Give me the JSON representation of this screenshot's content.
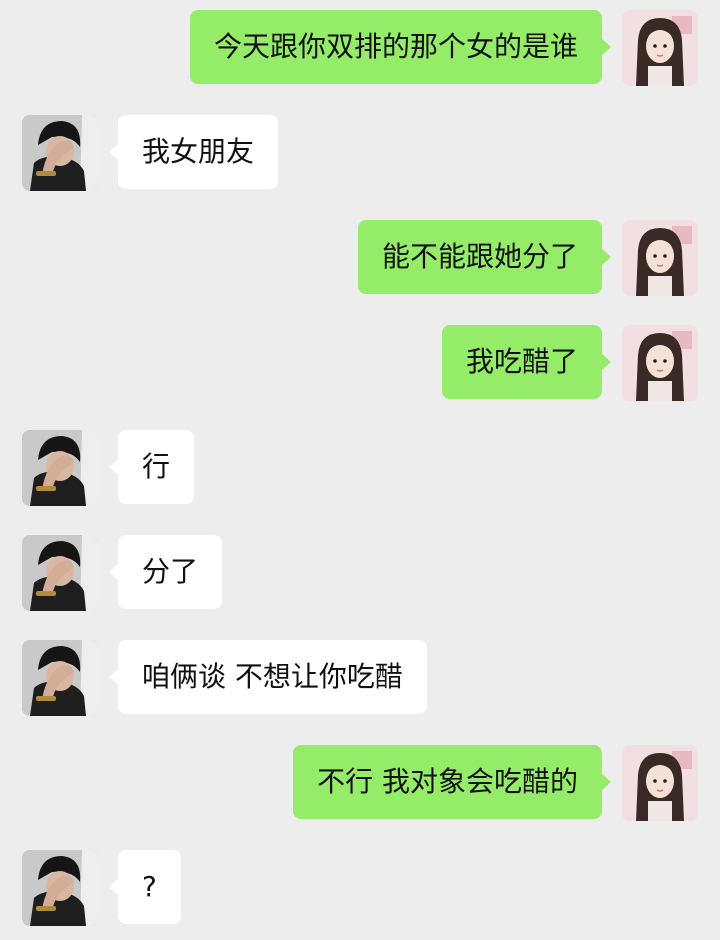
{
  "colors": {
    "background": "#ededed",
    "sent_bubble": "#95ec69",
    "received_bubble": "#ffffff",
    "text": "#111111"
  },
  "icons": {
    "self_avatar": "girl-long-hair-avatar",
    "contact_avatar": "boy-hand-on-face-avatar"
  },
  "messages": [
    {
      "side": "right",
      "text": "今天跟你双排的那个女的是谁"
    },
    {
      "side": "left",
      "text": "我女朋友"
    },
    {
      "side": "right",
      "text": "能不能跟她分了"
    },
    {
      "side": "right",
      "text": "我吃醋了"
    },
    {
      "side": "left",
      "text": "行"
    },
    {
      "side": "left",
      "text": "分了"
    },
    {
      "side": "left",
      "text": "咱俩谈 不想让你吃醋"
    },
    {
      "side": "right",
      "text": "不行 我对象会吃醋的"
    },
    {
      "side": "left",
      "text": "?"
    }
  ]
}
